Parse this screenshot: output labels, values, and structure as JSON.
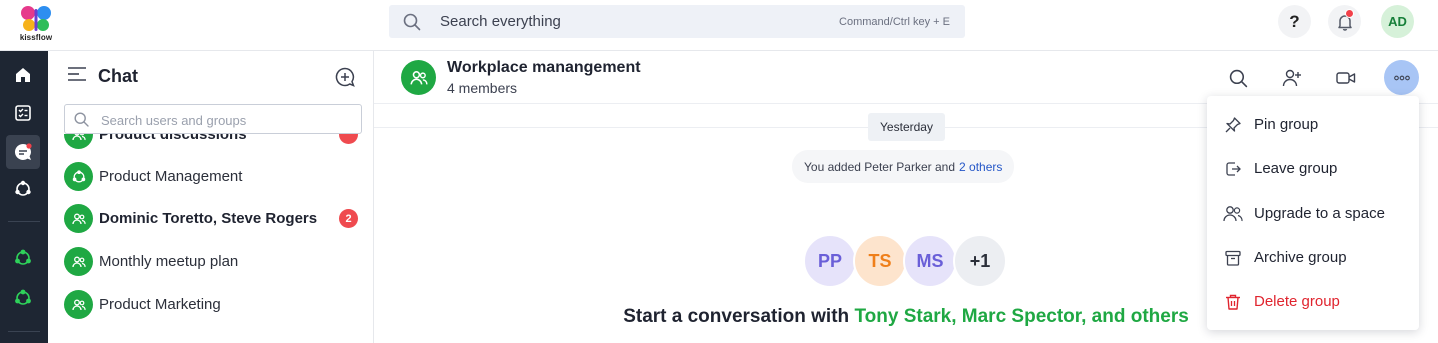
{
  "app": {
    "logo_text": "kissflow"
  },
  "search": {
    "placeholder": "Search everything",
    "shortcut_hint": "Command/Ctrl key + E"
  },
  "topbar": {
    "help_label": "?",
    "user_initials": "AD"
  },
  "sidebar": {
    "title": "Chat",
    "search_placeholder": "Search users and groups",
    "items": [
      {
        "name": "Product discussions",
        "bold": true,
        "badge": ""
      },
      {
        "name": "Product Management",
        "bold": false,
        "badge": ""
      },
      {
        "name": "Dominic Toretto, Steve Rogers",
        "bold": true,
        "badge": "2"
      },
      {
        "name": "Monthly meetup plan",
        "bold": false,
        "badge": ""
      },
      {
        "name": "Product Marketing",
        "bold": false,
        "badge": ""
      }
    ]
  },
  "chat": {
    "group_name": "Workplace manangement",
    "members_label": "4 members",
    "day_label": "Yesterday",
    "system_message": "You added Peter Parker and",
    "system_message_link": "2 others",
    "member_avatars": [
      {
        "initials": "PP",
        "bg": "#e6e3fa",
        "fg": "#6a5fd8"
      },
      {
        "initials": "TS",
        "bg": "#fde4cd",
        "fg": "#ef7f1a"
      },
      {
        "initials": "MS",
        "bg": "#e6e3fa",
        "fg": "#6a5fd8"
      },
      {
        "initials": "+1",
        "bg": "#eceef2",
        "fg": "#2b2f3a"
      }
    ],
    "start_prefix": "Start a conversation with",
    "start_names": "Tony Stark, Marc Spector, and others"
  },
  "menu": {
    "items": [
      {
        "label": "Pin group",
        "icon": "pin-icon"
      },
      {
        "label": "Leave group",
        "icon": "leave-icon"
      },
      {
        "label": "Upgrade to a space",
        "icon": "users-icon"
      },
      {
        "label": "Archive group",
        "icon": "archive-icon"
      },
      {
        "label": "Delete group",
        "icon": "trash-icon"
      }
    ]
  },
  "colors": {
    "brand_green": "#1fa843",
    "rail_bg": "#1e2633",
    "badge_red": "#ef4a4f",
    "danger": "#e0242e",
    "more_button": "#a8c5f5"
  }
}
